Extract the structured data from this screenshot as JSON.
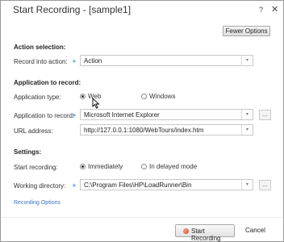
{
  "window": {
    "title": "Start Recording - [sample1]",
    "help": "?",
    "close": "✕"
  },
  "toolbar": {
    "fewer_options_label": "Fewer Options"
  },
  "action_selection": {
    "heading": "Action selection:",
    "record_into_label": "Record into action:",
    "record_into_value": "Action"
  },
  "application": {
    "heading": "Application to record:",
    "type_label": "Application type:",
    "type_options": [
      "Web",
      "Windows"
    ],
    "type_selected": "Web",
    "app_label": "Application to record:",
    "app_value": "Microsoft Internet Explorer",
    "url_label": "URL address:",
    "url_value": "http://127.0.0.1:1080/WebTours/index.htm"
  },
  "settings": {
    "heading": "Settings:",
    "start_label": "Start recording:",
    "start_options": [
      "Immediately",
      "In delayed mode"
    ],
    "start_selected": "Immediately",
    "dir_label": "Working directory:",
    "dir_value": "C:\\Program Files\\HP\\LoadRunner\\Bin"
  },
  "required_marker": "∗",
  "browse_label": "...",
  "dropdown_glyph": "▾",
  "recording_options_link": "Recording Options",
  "footer": {
    "start_label": "Start Recording",
    "cancel_label": "Cancel"
  },
  "colors": {
    "link": "#3a72c4",
    "required": "#5a8fd0",
    "record_dot": "#d2452a"
  }
}
